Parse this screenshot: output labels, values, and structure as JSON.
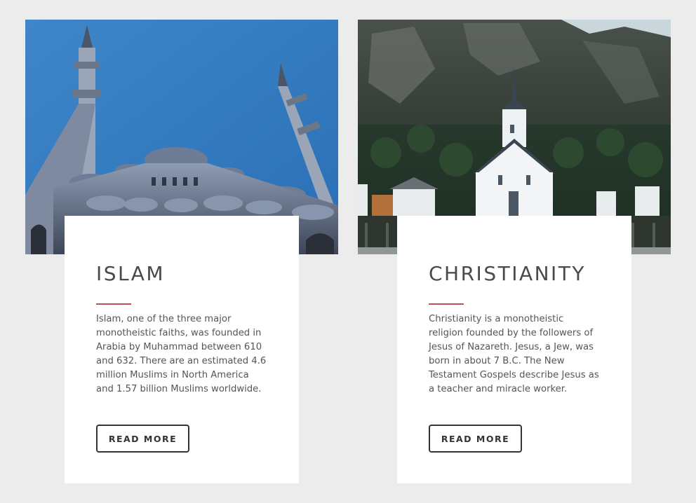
{
  "cards": [
    {
      "title": "ISLAM",
      "image_name": "mosque-photo",
      "description": "Islam, one of the three major monotheistic faiths, was founded in Arabia by Muhammad between 610 and 632. There are an estimated 4.6 million Muslims in North America and 1.57 billion Muslims worldwide.",
      "button_label": "READ MORE"
    },
    {
      "title": "CHRISTIANITY",
      "image_name": "church-photo",
      "description": "Christianity is a monotheistic religion founded by the followers of Jesus of Nazareth. Jesus, a Jew, was born in about 7 B.C. The New Testament Gospels describe Jesus as a teacher and miracle worker.",
      "button_label": "READ MORE"
    }
  ],
  "colors": {
    "page_background": "#ececec",
    "card_background": "#ffffff",
    "accent_line": "#c0504d",
    "title_text": "#4a4a4a",
    "body_text": "#555555",
    "button_border": "#333333"
  }
}
